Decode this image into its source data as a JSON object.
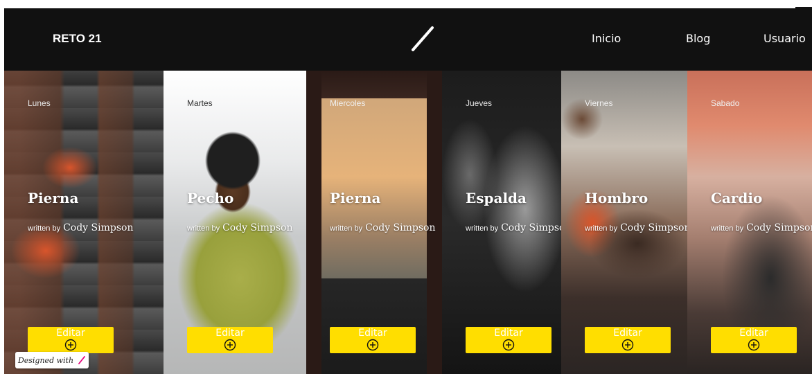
{
  "nav": {
    "brand": "RETO 21",
    "links": [
      "Inicio",
      "Blog",
      "Usuario"
    ]
  },
  "cards": [
    {
      "day": "Lunes",
      "title": "Pierna",
      "written_by": "written by",
      "author": "Cody Simpson",
      "button": "Editar"
    },
    {
      "day": "Martes",
      "title": "Pecho",
      "written_by": "written by",
      "author": "Cody Simpson",
      "button": "Editar"
    },
    {
      "day": "Miercoles",
      "title": "Pierna",
      "written_by": "written by",
      "author": "Cody Simpson",
      "button": "Editar"
    },
    {
      "day": "Jueves",
      "title": "Espalda",
      "written_by": "written by",
      "author": "Cody Simpson",
      "button": "Editar"
    },
    {
      "day": "Viernes",
      "title": "Hombro",
      "written_by": "written by",
      "author": "Cody Simpson",
      "button": "Editar"
    },
    {
      "day": "Sabado",
      "title": "Cardio",
      "written_by": "written by",
      "author": "Cody Simpson",
      "button": "Editar"
    }
  ],
  "badge": {
    "text": "Designed with"
  },
  "colors": {
    "nav_bg": "#111111",
    "button": "#ffde00",
    "accent": "#e5007a"
  }
}
